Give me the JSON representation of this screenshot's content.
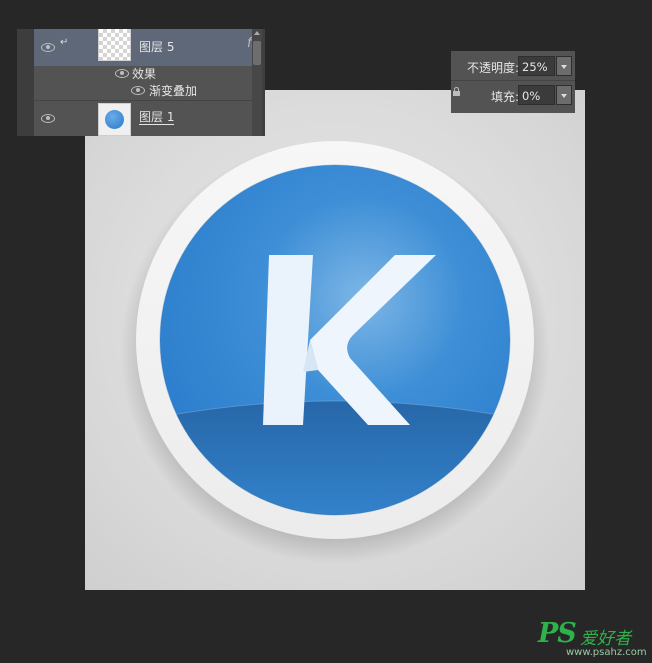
{
  "layers_panel": {
    "layers": [
      {
        "name": "图层 5",
        "selected": true,
        "clipped": true,
        "has_fx": true,
        "fx_label": "fx",
        "thumb": "transparent-checker"
      },
      {
        "name": "图层 1",
        "selected": false,
        "clipped": false,
        "has_fx": false,
        "thumb": "blue-circle"
      }
    ],
    "effects_label": "效果",
    "effect_items": [
      "渐变叠加"
    ]
  },
  "opacity_panel": {
    "opacity_label": "不透明度:",
    "opacity_value": "25%",
    "fill_label": "填充:",
    "fill_value": "0%"
  },
  "canvas": {
    "icon_letter": "K",
    "colors": {
      "ring": "#f2f2f2",
      "disc_light": "#6aaae0",
      "disc_mid": "#3587d2",
      "disc_dark": "#2a70b3",
      "letter": "#eaf3fc"
    }
  },
  "watermark": {
    "brand": "PS",
    "brand_cn": "爱好者",
    "url": "www.psahz.com"
  }
}
